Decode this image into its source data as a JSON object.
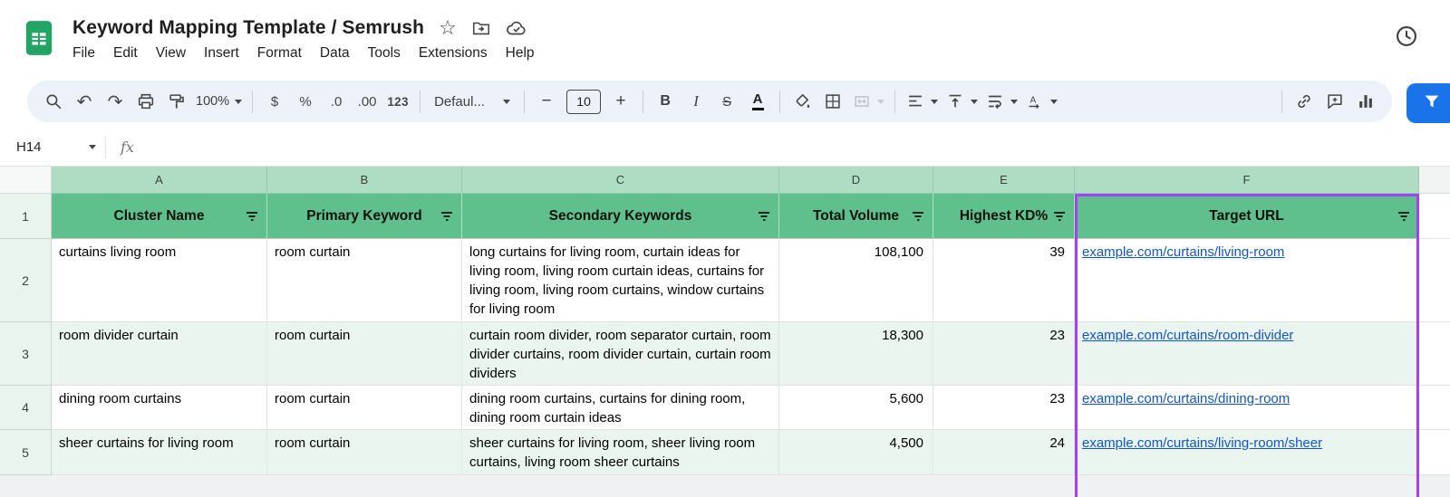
{
  "app": {
    "title": "Keyword Mapping Template / Semrush"
  },
  "menus": [
    "File",
    "Edit",
    "View",
    "Insert",
    "Format",
    "Data",
    "Tools",
    "Extensions",
    "Help"
  ],
  "toolbar": {
    "zoom": "100%",
    "currency": "$",
    "percent": "%",
    "decrease_decimal": ".0",
    "increase_decimal": ".00",
    "number_format": "123",
    "font": "Defaul...",
    "minus": "−",
    "font_size": "10",
    "plus": "+",
    "bold": "B",
    "italic": "I",
    "strikethrough": "S",
    "text_color": "A"
  },
  "formula_bar": {
    "cell_ref": "H14",
    "fx_label": "fx"
  },
  "grid": {
    "column_letters": [
      "A",
      "B",
      "C",
      "D",
      "E",
      "F"
    ],
    "row_numbers": [
      "1",
      "2",
      "3",
      "4",
      "5"
    ],
    "headers": [
      "Cluster Name",
      "Primary Keyword",
      "Secondary Keywords",
      "Total Volume",
      "Highest KD%",
      "Target URL"
    ],
    "rows": [
      {
        "cluster_name": "curtains living room",
        "primary_keyword": "room curtain",
        "secondary_keywords": "long curtains for living room, curtain ideas for living room, living room curtain ideas, curtains for living room, living room curtains, window curtains for living room",
        "total_volume": "108,100",
        "highest_kd": "39",
        "target_url": "example.com/curtains/living-room"
      },
      {
        "cluster_name": "room divider curtain",
        "primary_keyword": "room curtain",
        "secondary_keywords": "curtain room divider, room separator curtain, room divider curtains, room divider curtain, curtain room dividers",
        "total_volume": "18,300",
        "highest_kd": "23",
        "target_url": "example.com/curtains/room-divider"
      },
      {
        "cluster_name": "dining room curtains",
        "primary_keyword": "room curtain",
        "secondary_keywords": "dining room curtains, curtains for dining room, dining room curtain ideas",
        "total_volume": "5,600",
        "highest_kd": "23",
        "target_url": "example.com/curtains/dining-room"
      },
      {
        "cluster_name": "sheer curtains for living room",
        "primary_keyword": "room curtain",
        "secondary_keywords": "sheer curtains for living room, sheer living room curtains, living room sheer curtains",
        "total_volume": "4,500",
        "highest_kd": "24",
        "target_url": "example.com/curtains/living-room/sheer"
      }
    ]
  },
  "colors": {
    "logo_green": "#21a464",
    "header_green": "#5fc08d",
    "col_letter_green": "#aeddc4",
    "band_green": "#e9f5ee",
    "gutter_green": "#eaf4ee",
    "selection_purple": "#a142f4",
    "link_blue": "#1155cc",
    "filter_blue": "#1a73e8",
    "toolbar_bg": "#edf2fa"
  }
}
